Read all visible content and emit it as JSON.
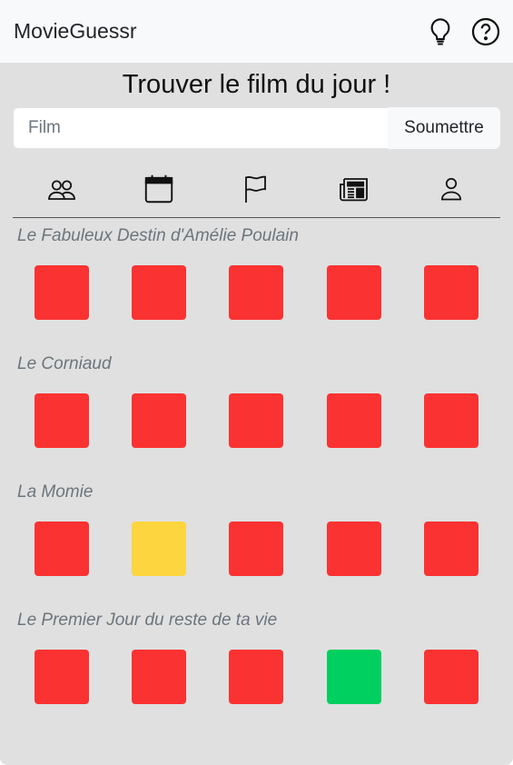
{
  "app": {
    "brand": "MovieGuessr"
  },
  "header": {
    "icons": [
      "lightbulb-icon",
      "question-circle-icon"
    ]
  },
  "main": {
    "title": "Trouver le film du jour !",
    "search": {
      "placeholder": "Film",
      "value": ""
    },
    "submit_label": "Soumettre",
    "categories": [
      "people-icon",
      "calendar-icon",
      "flag-icon",
      "newspaper-icon",
      "person-icon"
    ]
  },
  "colors": {
    "wrong": "#fb3232",
    "partial": "#fdd53e",
    "correct": "#00d05f"
  },
  "guesses": [
    {
      "title": "Le Fabuleux Destin d'Amélie Poulain",
      "results": [
        "wrong",
        "wrong",
        "wrong",
        "wrong",
        "wrong"
      ]
    },
    {
      "title": "Le Corniaud",
      "results": [
        "wrong",
        "wrong",
        "wrong",
        "wrong",
        "wrong"
      ]
    },
    {
      "title": "La Momie",
      "results": [
        "wrong",
        "partial",
        "wrong",
        "wrong",
        "wrong"
      ]
    },
    {
      "title": "Le Premier Jour du reste de ta vie",
      "results": [
        "wrong",
        "wrong",
        "wrong",
        "correct",
        "wrong"
      ]
    }
  ]
}
